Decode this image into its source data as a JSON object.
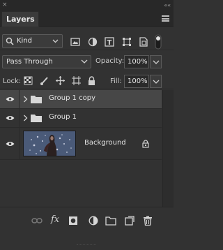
{
  "panel": {
    "tab_label": "Layers",
    "tab_close": "×",
    "collapse_arrows": "««"
  },
  "filter": {
    "kind_label": "Kind",
    "icons": [
      "image-filter-icon",
      "adjustment-filter-icon",
      "type-filter-icon",
      "shape-filter-icon",
      "smart-object-filter-icon",
      "filter-toggle-icon"
    ]
  },
  "blend": {
    "mode": "Pass Through",
    "opacity_label": "Opacity:",
    "opacity_value": "100%"
  },
  "lock": {
    "label": "Lock:",
    "fill_label": "Fill:",
    "fill_value": "100%",
    "icons": [
      "lock-transparent-icon",
      "lock-image-icon",
      "lock-position-icon",
      "lock-artboard-icon",
      "lock-all-icon"
    ]
  },
  "layers": [
    {
      "name": "Group 1 copy",
      "type": "group",
      "visible": true,
      "selected": true
    },
    {
      "name": "Group 1",
      "type": "group",
      "visible": true,
      "selected": false
    },
    {
      "name": "Background",
      "type": "pixel",
      "visible": true,
      "selected": false,
      "locked": true
    }
  ],
  "footer": {
    "icons": [
      "link-layers-icon",
      "fx-icon",
      "add-mask-icon",
      "new-adjustment-icon",
      "new-group-icon",
      "new-layer-icon",
      "delete-icon"
    ],
    "fx_label": "fx"
  },
  "colors": {
    "panel_bg": "#323232",
    "selected_row": "#474747",
    "text": "#e2e2e2"
  }
}
